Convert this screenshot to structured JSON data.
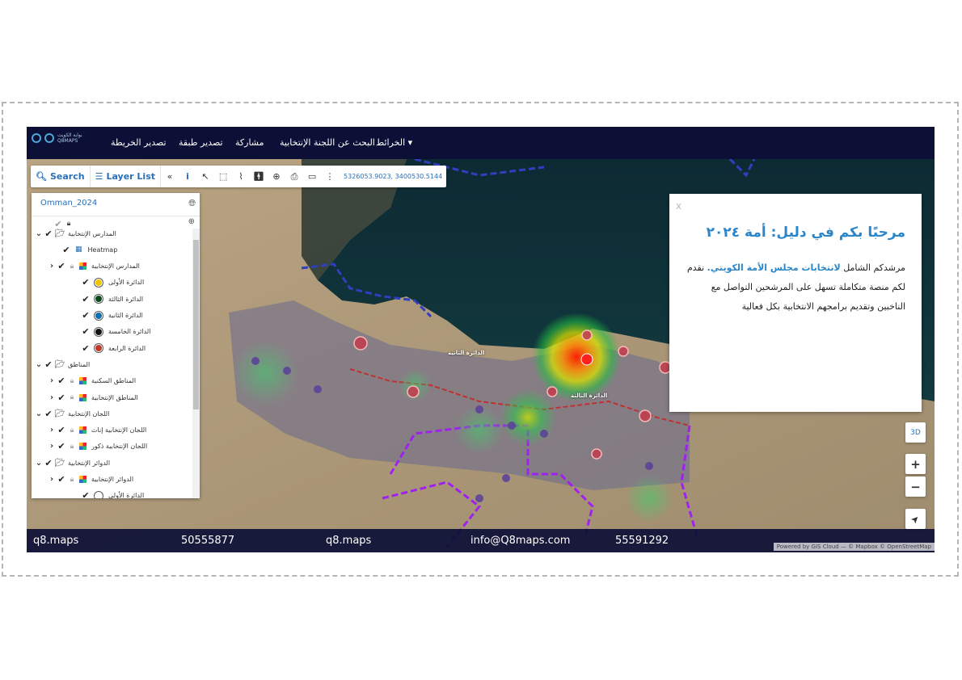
{
  "navbar": {
    "logo_text": "بوابة الكويت Q8MAPS",
    "items": [
      "تصدير الخريطة",
      "تصدير طبقة",
      "مشاركة",
      "البحث عن اللجنة الإنتخابية",
      "البحث عن اللجنة الإنتخابية",
      "الخرائط ▾"
    ]
  },
  "toolbar": {
    "search_label": "Search",
    "layer_list_label": "Layer List",
    "coordinates": "5326053.9023, 3400530.5144"
  },
  "layer_panel": {
    "map_name": "Omman_2024",
    "rows": [
      {
        "label": "المدارس الإنتخابية",
        "kind": "group"
      },
      {
        "label": "Heatmap",
        "kind": "layer"
      },
      {
        "label": "المدارس الإنتخابية",
        "kind": "sublayer"
      },
      {
        "label": "الدائرة الأولى",
        "kind": "class",
        "color": "#f5c400"
      },
      {
        "label": "الدائرة الثالثة",
        "kind": "class",
        "color": "#0a4a1a"
      },
      {
        "label": "الدائرة الثانية",
        "kind": "class",
        "color": "#0b6fb0"
      },
      {
        "label": "الدائرة الخامسة",
        "kind": "class",
        "color": "#111111"
      },
      {
        "label": "الدائرة الرابعة",
        "kind": "class",
        "color": "#c0392b"
      },
      {
        "label": "المناطق",
        "kind": "group"
      },
      {
        "label": "المناطق السكنية",
        "kind": "sublayer"
      },
      {
        "label": "المناطق الإنتخابية",
        "kind": "sublayer"
      },
      {
        "label": "اللجان الإنتخابية",
        "kind": "group"
      },
      {
        "label": "اللجان الإنتخابية إناث",
        "kind": "sublayer"
      },
      {
        "label": "اللجان الإنتخابية ذكور",
        "kind": "sublayer"
      },
      {
        "label": "الدوائر الإنتخابية",
        "kind": "group"
      },
      {
        "label": "الدوائر الإنتخابية",
        "kind": "sublayer"
      },
      {
        "label": "الدائرة الأولى",
        "kind": "class",
        "color": "#ffffff"
      }
    ]
  },
  "popup": {
    "close": "x",
    "title": "مرحبًا بكم في دليل: أمة ٢٠٢٤",
    "body_prefix": "مرشدكم الشامل",
    "body_link": "لانتخابات مجلس الأمة الكويتي.",
    "body_rest": "نقدم لكم منصة متكاملة تسهل على المرشحين التواصل مع الناخبين وتقديم برامجهم الانتخابية بكل فعالية"
  },
  "map_controls": {
    "three_d": "3D",
    "zoom_in": "+",
    "zoom_out": "−",
    "locate": "➤"
  },
  "map_labels": [
    "الدائرة الثانية",
    "الدائرة الثالثة"
  ],
  "footer": {
    "brand_left": "q8.maps",
    "phone_1": "50555877",
    "brand_center": "q8.maps",
    "email": "info@Q8maps.com",
    "phone_2": "55591292"
  },
  "attribution": "Powered by GIS Cloud — © Mapbox © OpenStreetMap",
  "icons": [
    "search-icon",
    "list-icon",
    "double-chevron-icon",
    "info-icon",
    "cursor-icon",
    "select-box-icon",
    "measure-icon",
    "person-icon",
    "zoom-icon",
    "print-icon",
    "ruler-icon",
    "globe-icon",
    "lock-icon",
    "folder-icon",
    "checkmark-icon",
    "chevron-down-icon",
    "chevron-right-icon"
  ]
}
